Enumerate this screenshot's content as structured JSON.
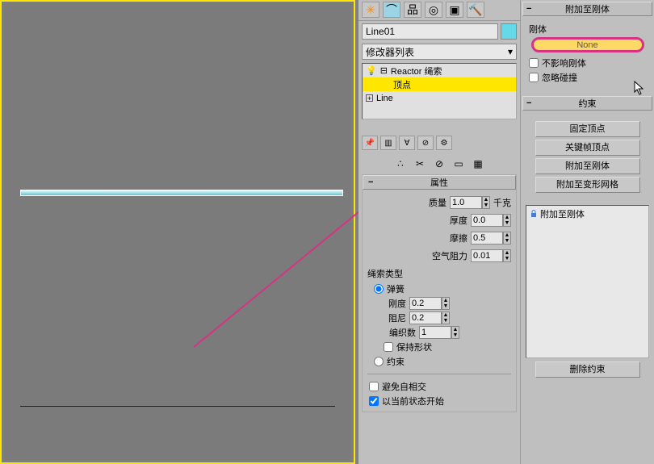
{
  "object_name": "Line01",
  "modifier_dropdown": "修改器列表",
  "hierarchy": {
    "row1": "Reactor 绳索",
    "row2": "顶点",
    "row3": "Line"
  },
  "rollout_properties": {
    "title": "属性",
    "mass_label": "质量",
    "mass_value": "1.0",
    "mass_unit": "千克",
    "thickness_label": "厚度",
    "thickness_value": "0.0",
    "friction_label": "摩擦",
    "friction_value": "0.5",
    "air_label": "空气阻力",
    "air_value": "0.01",
    "rope_type_label": "绳索类型",
    "radio_spring": "弹簧",
    "stiffness_label": "刚度",
    "stiffness_value": "0.2",
    "damping_label": "阻尼",
    "damping_value": "0.2",
    "weave_label": "编织数",
    "weave_value": "1",
    "preserve_shape": "保持形状",
    "radio_constraint": "约束",
    "avoid_self_intersect": "避免自相交",
    "start_current": "以当前状态开始"
  },
  "far_right": {
    "attach_header": "附加至刚体",
    "rigidbody_label": "刚体",
    "none_button": "None",
    "no_affect_rigid": "不影响刚体",
    "ignore_collision": "忽略碰撞",
    "constraint_header": "约束",
    "btn_fix_vertex": "固定顶点",
    "btn_keyframe_vertex": "关键帧顶点",
    "btn_attach_rigid": "附加至刚体",
    "btn_attach_deform": "附加至变形网格",
    "list_item": "附加至刚体",
    "btn_delete_constraint": "删除约束"
  }
}
